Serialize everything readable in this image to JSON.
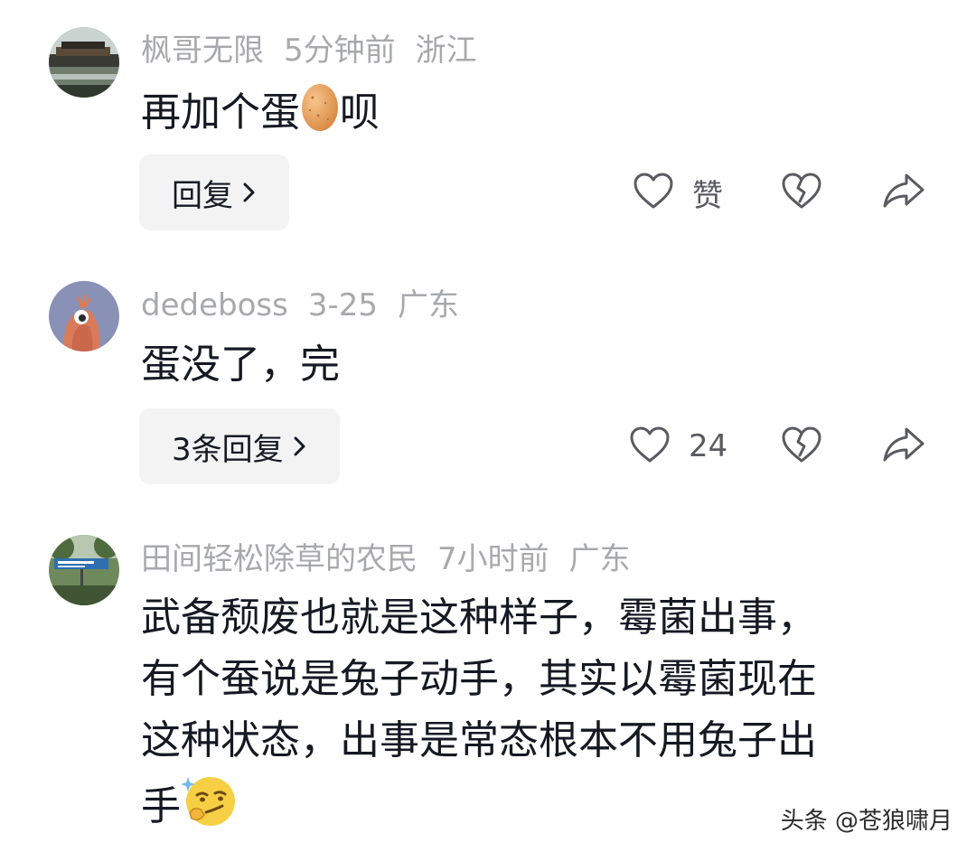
{
  "comments": [
    {
      "username": "枫哥无限",
      "time": "5分钟前",
      "location": "浙江",
      "text_before": "再加个蛋",
      "emoji": "egg-emoji",
      "text_after": "呗",
      "reply_label": "回复",
      "like_label": "赞"
    },
    {
      "username": "dedeboss",
      "time": "3-25",
      "location": "广东",
      "text": "蛋没了，完",
      "reply_label": "3条回复",
      "like_label": "24"
    },
    {
      "username": "田间轻松除草的农民",
      "time": "7小时前",
      "location": "广东",
      "lines": [
        "武备颓废也就是这种样子，霉菌出事，",
        "有个蚕说是兔子动手，其实以霉菌现在",
        "这种状态，出事是常态根本不用兔子出",
        "手"
      ],
      "emoji": "smirk-emoji"
    }
  ],
  "watermark": "头条 @苍狼啸月",
  "colors": {
    "meta_text": "#a8a9ad",
    "body_text": "#161823",
    "reply_bg": "#f3f3f4",
    "icon_stroke": "#5a5b62"
  }
}
